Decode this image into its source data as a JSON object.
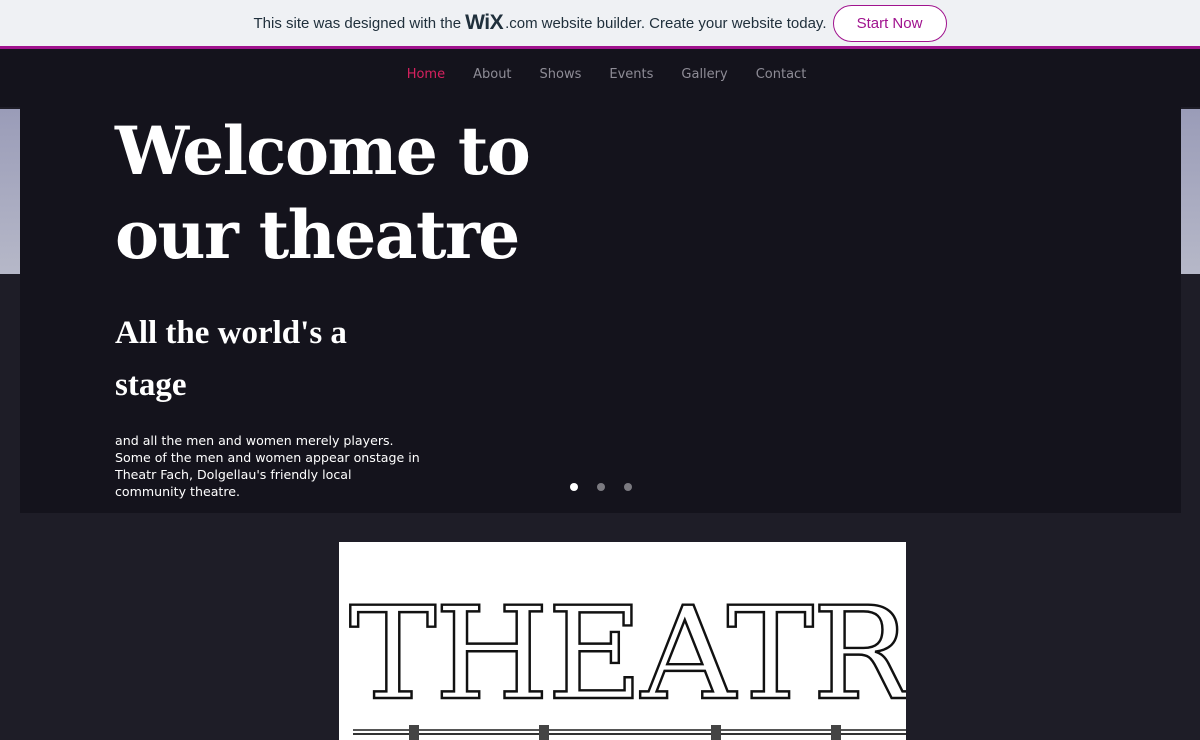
{
  "wix_banner": {
    "text_before": "This site was designed with the",
    "logo": "WiX",
    "dotcom": ".com",
    "text_after": "website builder. Create your website today.",
    "cta_label": "Start Now",
    "accent_color": "#a0138e"
  },
  "nav": {
    "items": [
      {
        "label": "Home",
        "active": true
      },
      {
        "label": "About",
        "active": false
      },
      {
        "label": "Shows",
        "active": false
      },
      {
        "label": "Events",
        "active": false
      },
      {
        "label": "Gallery",
        "active": false
      },
      {
        "label": "Contact",
        "active": false
      }
    ],
    "active_color": "#d6215f"
  },
  "hero": {
    "title_line1": "Welcome to",
    "title_line2": "our theatre",
    "subtitle_line1": "All the world's a",
    "subtitle_line2": "stage",
    "body_line1": "and all the men and women merely players.",
    "body_line2": "Some of the men and women appear onstage in",
    "body_line3": "Theatr Fach, Dolgellau's friendly local",
    "body_line4": "community theatre.",
    "slides": [
      {
        "active": true
      },
      {
        "active": false
      },
      {
        "active": false
      }
    ]
  },
  "logo_image": {
    "text": "THEATR"
  }
}
